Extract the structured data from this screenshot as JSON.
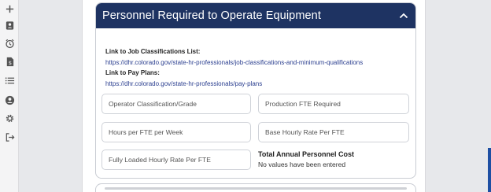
{
  "sidebar": {
    "icons": [
      "plus-icon",
      "contact-card-icon",
      "alarm-clock-icon",
      "document-dollar-icon",
      "list-icon",
      "user-icon",
      "gear-icon",
      "logout-icon"
    ]
  },
  "section": {
    "title": "Personnel Required to Operate Equipment",
    "job_classifications_label": "Link to Job Classifications List:",
    "job_classifications_url": "https://dhr.colorado.gov/state-hr-professionals/job-classifications-and-minimum-qualifications",
    "pay_plans_label": "Link to Pay Plans:",
    "pay_plans_url": "https://dhr.colorado.gov/state-hr-professionals/pay-plans"
  },
  "fields": {
    "operator_classification": "Operator Classification/Grade",
    "production_fte": "Production FTE Required",
    "hours_per_fte": "Hours per FTE per Week",
    "base_hourly_rate": "Base Hourly Rate Per FTE",
    "fully_loaded_rate": "Fully Loaded Hourly Rate Per FTE"
  },
  "totals": {
    "label": "Total Annual Personnel Cost",
    "value": "No values have been entered"
  },
  "colors": {
    "header_bg": "#1e3362",
    "link": "#2a3e8f",
    "accent": "#1e4fa3"
  }
}
